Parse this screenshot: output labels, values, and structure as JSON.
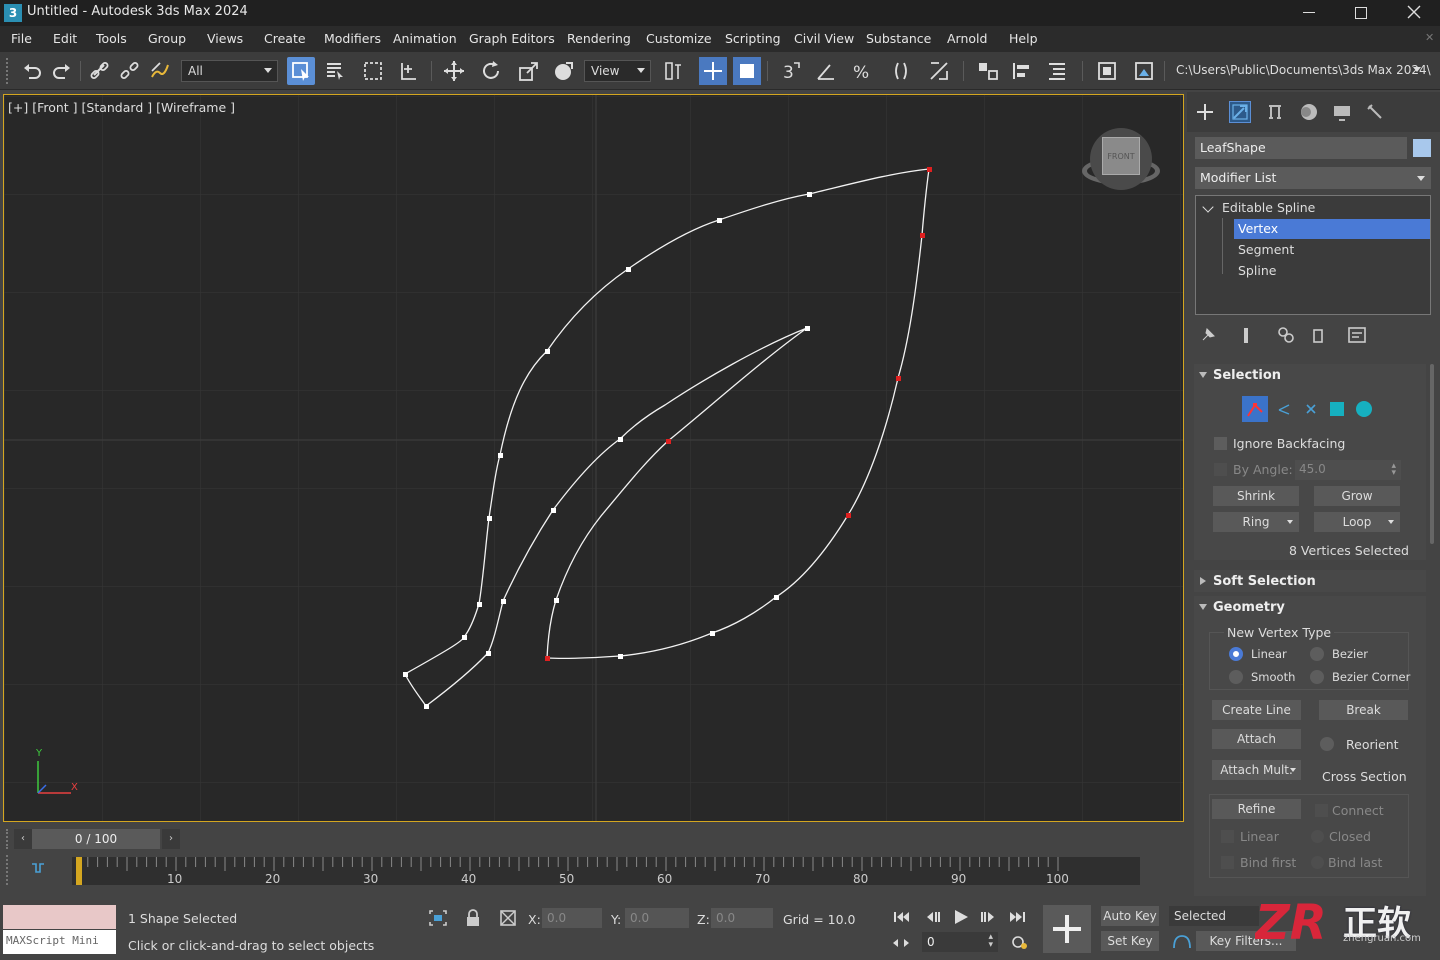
{
  "window": {
    "title": "Untitled - Autodesk 3ds Max 2024",
    "app_icon": "3",
    "controls": [
      "minimize-icon",
      "restore-icon",
      "close-icon"
    ]
  },
  "menu": {
    "items": [
      "File",
      "Edit",
      "Tools",
      "Group",
      "Views",
      "Create",
      "Modifiers",
      "Animation",
      "Graph Editors",
      "Rendering",
      "Customize",
      "Scripting",
      "Civil View",
      "Substance",
      "Arnold",
      "Help"
    ]
  },
  "toolbar": {
    "selection_filter": "All",
    "reference_coord": "View",
    "project_path": "C:\\Users\\Public\\Documents\\3ds Max 2024\\"
  },
  "viewport": {
    "label": "[+] [Front ] [Standard ] [Wireframe ]",
    "viewcube_label": "FRONT",
    "axis_y": "Y",
    "axis_x": "X",
    "colors": {
      "spline": "#f2f2f2",
      "vertex": "#ffffff",
      "vertex_selected": "#e02020",
      "border": "#d4a620"
    }
  },
  "command_panel": {
    "object_name": "LeafShape",
    "object_color": "#a8c8ec",
    "modifier_list": "Modifier List",
    "stack": {
      "base": "Editable Spline",
      "levels": [
        "Vertex",
        "Segment",
        "Spline"
      ],
      "active": "Vertex"
    },
    "selection": {
      "title": "Selection",
      "ignore_backfacing": "Ignore Backfacing",
      "by_angle_label": "By Angle:",
      "by_angle_value": "45.0",
      "shrink": "Shrink",
      "grow": "Grow",
      "ring": "Ring",
      "loop": "Loop",
      "status": "8 Vertices Selected"
    },
    "soft_selection": {
      "title": "Soft Selection"
    },
    "geometry": {
      "title": "Geometry",
      "new_vertex_type": "New Vertex Type",
      "linear": "Linear",
      "bezier": "Bezier",
      "smooth": "Smooth",
      "bezier_corner": "Bezier Corner",
      "create_line": "Create Line",
      "break": "Break",
      "attach": "Attach",
      "reorient": "Reorient",
      "attach_mult": "Attach Mult.",
      "cross_section": "Cross Section",
      "refine": "Refine",
      "connect": "Connect",
      "linear2": "Linear",
      "closed": "Closed",
      "bind_first": "Bind first",
      "bind_last": "Bind last"
    }
  },
  "timeline": {
    "frame_display": "0 / 100",
    "ruler": [
      "10",
      "20",
      "30",
      "40",
      "50",
      "60",
      "70",
      "80",
      "90",
      "100"
    ]
  },
  "status": {
    "maxscript": "MAXScript Mini",
    "selection_info": "1 Shape Selected",
    "prompt": "Click or click-and-drag to select objects",
    "x_label": "X:",
    "x_value": "0.0",
    "y_label": "Y:",
    "y_value": "0.0",
    "z_label": "Z:",
    "z_value": "0.0",
    "grid": "Grid = 10.0",
    "frame_value": "0",
    "auto_key": "Auto Key",
    "set_key": "Set Key",
    "selected": "Selected",
    "key_filters": "Key Filters..."
  },
  "watermark": {
    "text": "正软",
    "sub": "zhengruan.com"
  }
}
